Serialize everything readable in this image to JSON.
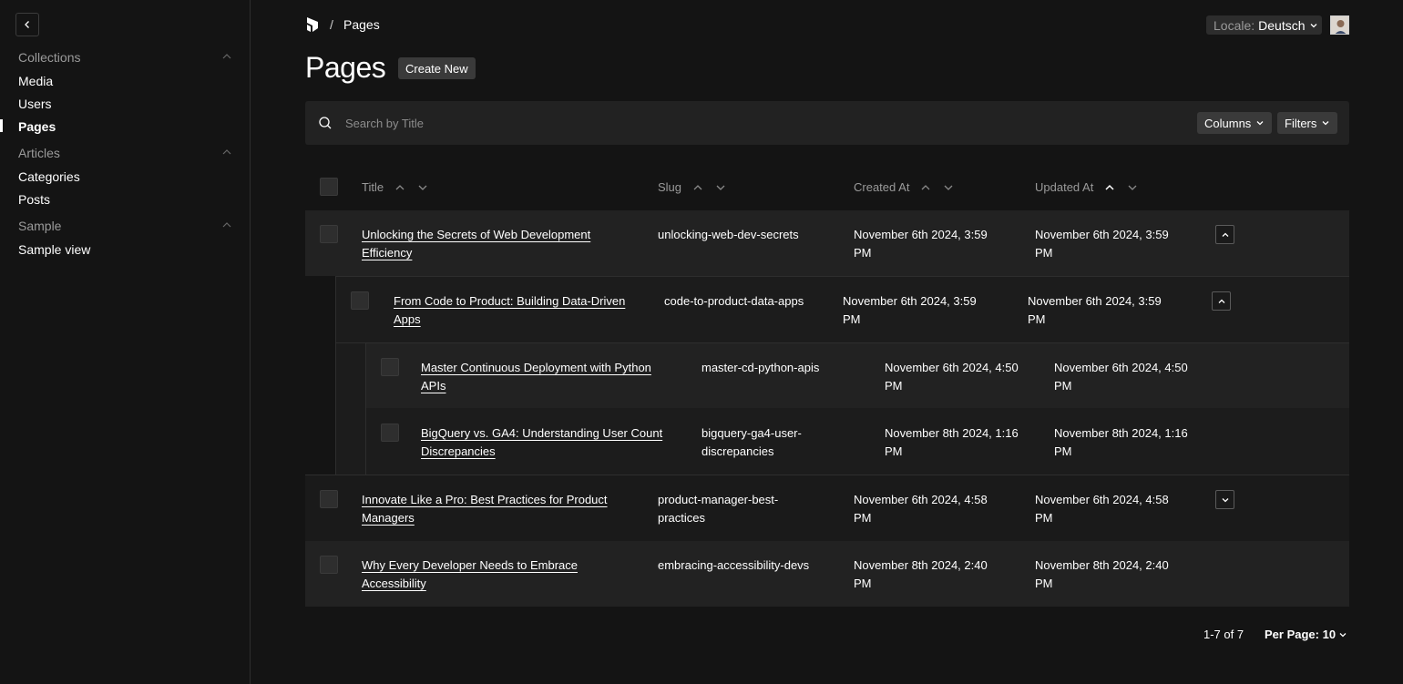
{
  "sidebar": {
    "groups": [
      {
        "label": "Collections",
        "items": [
          "Media",
          "Users",
          "Pages"
        ]
      },
      {
        "label": "Articles",
        "items": [
          "Categories",
          "Posts"
        ]
      },
      {
        "label": "Sample",
        "items": [
          "Sample view"
        ]
      }
    ],
    "active_item": "Pages"
  },
  "header": {
    "breadcrumb_separator": "/",
    "breadcrumb_current": "Pages",
    "locale_label": "Locale:",
    "locale_value": "Deutsch"
  },
  "page": {
    "title": "Pages",
    "create_label": "Create New"
  },
  "search": {
    "placeholder": "Search by Title",
    "columns_label": "Columns",
    "filters_label": "Filters"
  },
  "table": {
    "headers": [
      "Title",
      "Slug",
      "Created At",
      "Updated At"
    ],
    "rows": [
      {
        "title_line1": "Unlocking the Secrets of Web Development",
        "title_line2": "Efficiency",
        "slug_line1": "unlocking-web-dev-secrets",
        "slug_line2": "",
        "created_line1": "November 6th 2024, 3:59",
        "created_line2": "PM",
        "updated_line1": "November 6th 2024, 3:59",
        "updated_line2": "PM",
        "toggle": "collapse"
      },
      {
        "title_line1": "From Code to Product: Building Data-Driven",
        "title_line2": "Apps",
        "slug_line1": "code-to-product-data-apps",
        "slug_line2": "",
        "created_line1": "November 6th 2024, 3:59",
        "created_line2": "PM",
        "updated_line1": "November 6th 2024, 3:59",
        "updated_line2": "PM",
        "toggle": "collapse"
      },
      {
        "title_line1": "Master Continuous Deployment with Python",
        "title_line2": "APIs",
        "slug_line1": "master-cd-python-apis",
        "slug_line2": "",
        "created_line1": "November 6th 2024, 4:50",
        "created_line2": "PM",
        "updated_line1": "November 6th 2024, 4:50",
        "updated_line2": "PM",
        "toggle": ""
      },
      {
        "title_line1": "BigQuery vs. GA4: Understanding User Count",
        "title_line2": "Discrepancies",
        "slug_line1": "bigquery-ga4-user-",
        "slug_line2": "discrepancies",
        "created_line1": "November 8th 2024, 1:16",
        "created_line2": "PM",
        "updated_line1": "November 8th 2024, 1:16",
        "updated_line2": "PM",
        "toggle": ""
      },
      {
        "title_line1": "Innovate Like a Pro: Best Practices for Product",
        "title_line2": "Managers",
        "slug_line1": "product-manager-best-",
        "slug_line2": "practices",
        "created_line1": "November 6th 2024, 4:58",
        "created_line2": "PM",
        "updated_line1": "November 6th 2024, 4:58",
        "updated_line2": "PM",
        "toggle": "expand"
      },
      {
        "title_line1": "Why Every Developer Needs to Embrace",
        "title_line2": "Accessibility",
        "slug_line1": "embracing-accessibility-devs",
        "slug_line2": "",
        "created_line1": "November 8th 2024, 2:40",
        "created_line2": "PM",
        "updated_line1": "November 8th 2024, 2:40",
        "updated_line2": "PM",
        "toggle": ""
      }
    ]
  },
  "pagination": {
    "range": "1-7 of 7",
    "per_page_label": "Per Page: 10"
  }
}
